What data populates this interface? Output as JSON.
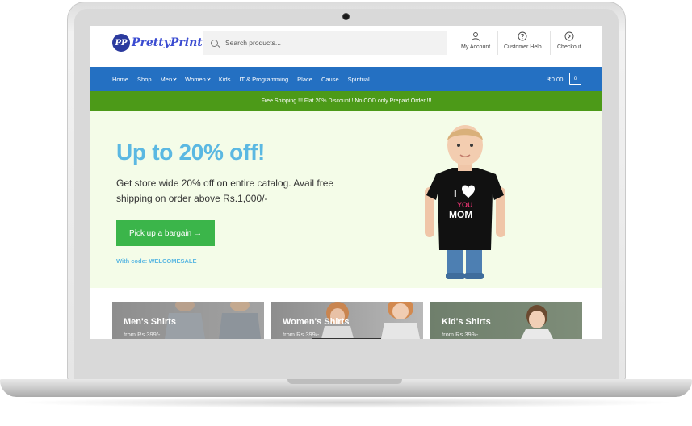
{
  "header": {
    "logo_badge": "PP",
    "logo_text": "PrettyPrint",
    "search_placeholder": "Search products...",
    "nav": [
      {
        "label": "My Account",
        "icon": "user-icon"
      },
      {
        "label": "Customer Help",
        "icon": "help-icon"
      },
      {
        "label": "Checkout",
        "icon": "arrow-right-circle-icon"
      }
    ]
  },
  "navbar": {
    "items": [
      {
        "label": "Home"
      },
      {
        "label": "Shop"
      },
      {
        "label": "Men"
      },
      {
        "label": "Women"
      },
      {
        "label": "Kids"
      },
      {
        "label": "IT & Programming"
      },
      {
        "label": "Place"
      },
      {
        "label": "Cause"
      },
      {
        "label": "Spiritual"
      }
    ],
    "cart_total": "₹0.00",
    "cart_count": "0"
  },
  "promo": {
    "text": "Free Shipping !!! Flat 20% Discount ! No COD only Prepaid Order !!!"
  },
  "hero": {
    "title": "Up to 20% off!",
    "text": "Get store wide 20% off on entire catalog. Avail free shipping on order above Rs.1,000/-",
    "button_label": "Pick up a bargain →",
    "code_text": "With code: WELCOMESALE",
    "shirt_text_1": "I",
    "shirt_text_2": "YOU",
    "shirt_text_3": "MOM"
  },
  "categories": [
    {
      "title": "Men's Shirts",
      "subtitle": "from Rs.399/-"
    },
    {
      "title": "Women's Shirts",
      "subtitle": "from Rs.399/-"
    },
    {
      "title": "Kid's Shirts",
      "subtitle": "from Rs.399/-"
    }
  ],
  "colors": {
    "navbar": "#2470c2",
    "promo": "#4c9a18",
    "hero_bg": "#f4fce8",
    "hero_title": "#5bb8e2",
    "button": "#3bb54a"
  }
}
